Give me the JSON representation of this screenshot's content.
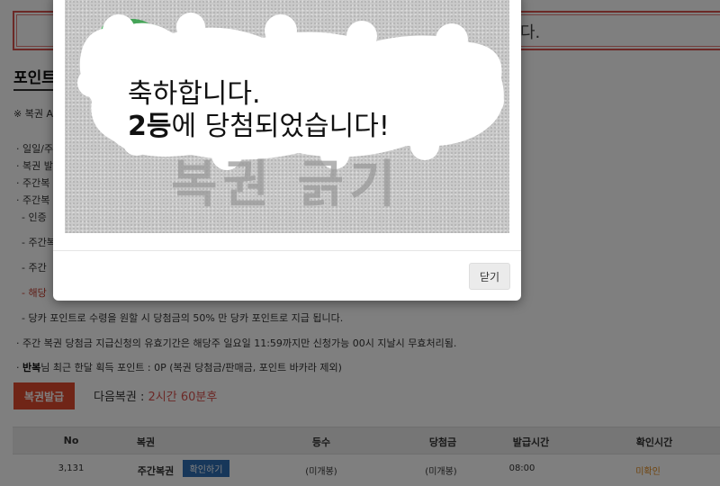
{
  "notice": {
    "text": "다."
  },
  "page": {
    "title": "포인트",
    "first_note": "※ 복권 A",
    "bullets": [
      "· 일일/주",
      "· 복권 발",
      "· 주간복",
      "· 주간복",
      "- 인증",
      "- 주간복",
      "- 주간",
      "- 해당",
      "- 당카 포인트로 수령을 원할 시 당첨금의 50% 만 당카 포인트로 지급 됩니다.",
      "· 주간 복권 당첨금 지급신청의 유효기간은 해당주 일요일 11:59까지만 신청가능 00시 지날시 무효처리됨."
    ],
    "user_line_prefix": "· ",
    "user_name": "반복",
    "user_line_suffix": "님 최근 한달 획득 포인트 : 0P (복권 당첨금/판매금, 포인트 바카라 제외)",
    "lotto_button": "복권발급",
    "next_label": "다음복권 : ",
    "next_time": "2시간 60분후"
  },
  "table": {
    "headers": [
      "No",
      "복권",
      "등수",
      "당첨금",
      "발급시간",
      "확인시간"
    ],
    "row": {
      "no": "3,131",
      "ticket": "주간복권",
      "confirm_button": "확인하기",
      "rank": "(미개봉)",
      "prize": "(미개봉)",
      "issued": "08:00",
      "checked": "미확인"
    }
  },
  "modal": {
    "scratch_title": "복권 긁기",
    "line1": "축하합니다.",
    "rank": "2등",
    "line2_rest": "에 당첨되었습니다!",
    "close_button": "닫기"
  },
  "colors": {
    "accent_red": "#e04a2f",
    "link_blue": "#2f6eb5",
    "pending_orange": "#e08a1e"
  }
}
